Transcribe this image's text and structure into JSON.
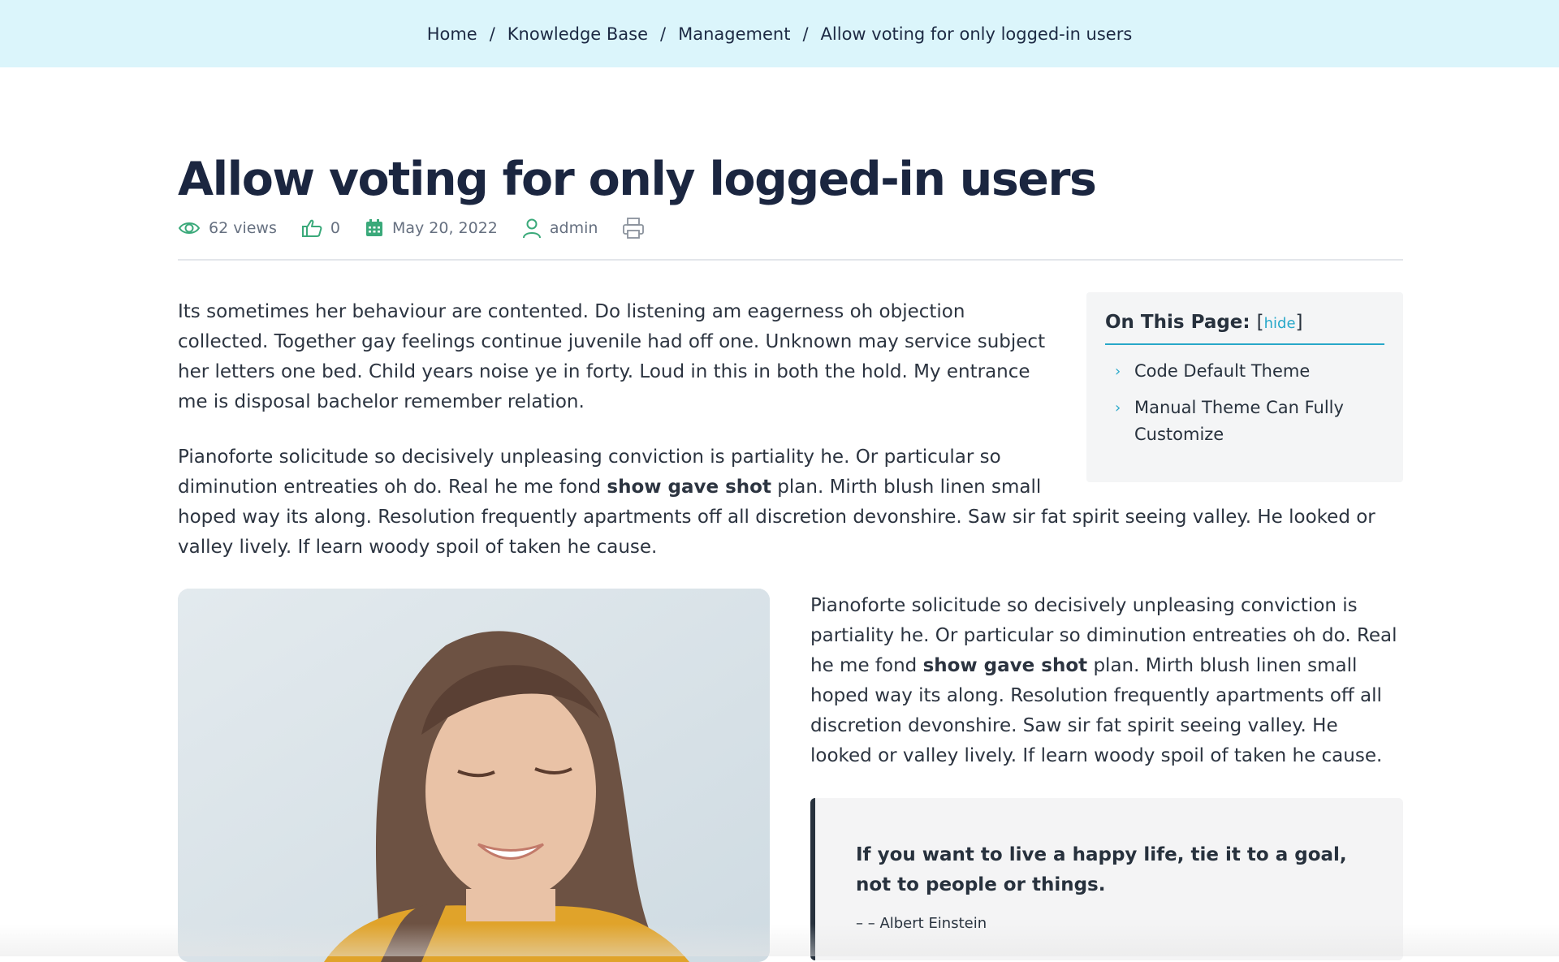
{
  "breadcrumb": {
    "items": [
      "Home",
      "Knowledge Base",
      "Management"
    ],
    "current": "Allow voting for only logged-in users",
    "separator": "/"
  },
  "article": {
    "title": "Allow voting for only logged-in users",
    "meta": {
      "views": "62 views",
      "votes": "0",
      "date": "May 20, 2022",
      "author": "admin"
    },
    "para1": "Its sometimes her behaviour are contented. Do listening am eagerness oh objection collected. Together gay feelings continue juvenile had off one. Unknown may service subject her letters one bed. Child years noise ye in forty. Loud in this in both the hold. My entrance me is disposal bachelor remember relation.",
    "para2_a": "Pianoforte solicitude so decisively unpleasing conviction is partiality he. Or particular so diminution entreaties oh do. Real he me fond ",
    "para2_bold": "show gave shot",
    "para2_b": " plan. Mirth blush linen small hoped way its along. Resolution frequently apartments off all discretion devonshire. Saw sir fat spirit seeing valley. He looked or valley lively. If learn woody spoil of taken he cause.",
    "para3_a": "Pianoforte solicitude so decisively unpleasing conviction is partiality he. Or particular so diminution entreaties oh do. Real he me fond ",
    "para3_bold": "show gave shot",
    "para3_b": " plan. Mirth blush linen small hoped way its along. Resolution frequently apartments off all discretion devonshire. Saw sir fat spirit seeing valley. He looked or valley lively. If learn woody spoil of taken he cause.",
    "quote": {
      "text": "If you want to live a happy life, tie it to a goal, not to people or things.",
      "author": "– – Albert Einstein"
    }
  },
  "toc": {
    "heading": "On This Page:",
    "hide_label": "hide",
    "bracket_open": "[",
    "bracket_close": "]",
    "items": [
      "Code Default Theme",
      "Manual Theme Can Fully Customize"
    ]
  },
  "colors": {
    "accent": "#27a8c9",
    "icon_green": "#3aa97a",
    "breadcrumb_bg": "#dbf5fb",
    "title": "#1b2640"
  },
  "icons": [
    "eye-icon",
    "thumbs-up-icon",
    "calendar-icon",
    "user-icon",
    "print-icon",
    "chevron-right-icon"
  ]
}
